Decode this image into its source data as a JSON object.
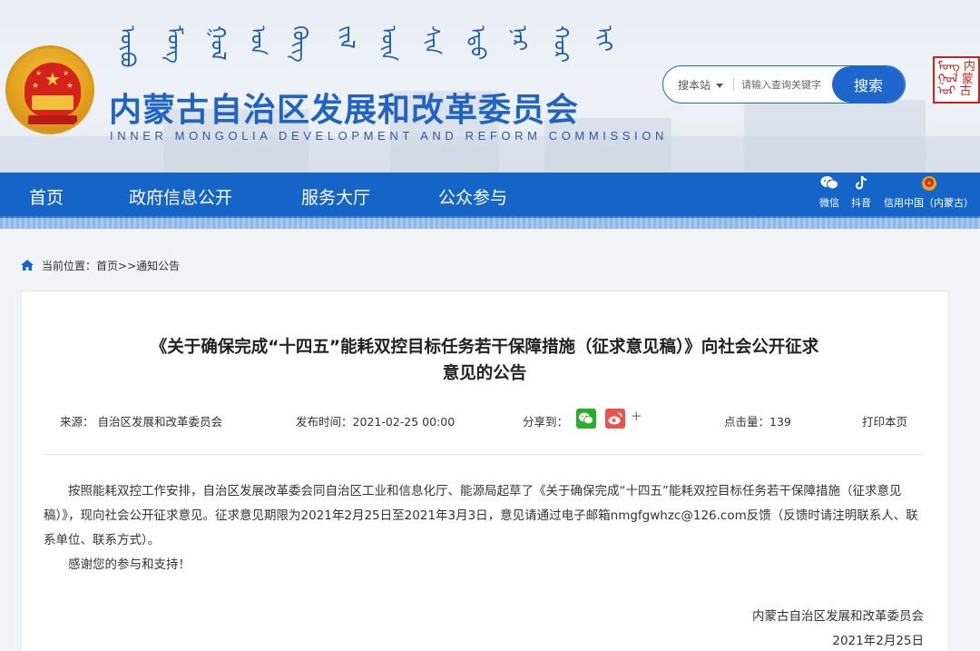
{
  "header": {
    "title": "内蒙古自治区发展和改革委员会",
    "subtitle": "INNER MONGOLIA DEVELOPMENT AND REFORM COMMISSION",
    "search": {
      "scope": "搜本站",
      "placeholder": "请输入查询关键字",
      "button": "搜索"
    }
  },
  "nav": {
    "items": [
      "首页",
      "政府信息公开",
      "服务大厅",
      "公众参与"
    ],
    "social": [
      {
        "label": "微信",
        "icon": "wechat-icon"
      },
      {
        "label": "抖音",
        "icon": "douyin-icon"
      },
      {
        "label": "信用中国（内蒙古）",
        "icon": "emblem-icon"
      }
    ]
  },
  "breadcrumb": {
    "prefix": "当前位置：",
    "home": "首页",
    "sep": ">>",
    "current": "通知公告"
  },
  "article": {
    "title_line1": "《关于确保完成“十四五”能耗双控目标任务若干保障措施（征求意见稿）》向社会公开征求",
    "title_line2": "意见的公告",
    "source": "来源：  自治区发展和改革委员会",
    "published": "发布时间：2021-02-25 00:00",
    "share_label": "分享到：",
    "share_more": "+",
    "views": "点击量：139",
    "print": "打印本页",
    "para1": "按照能耗双控工作安排，自治区发展改革委会同自治区工业和信息化厅、能源局起草了《关于确保完成“十四五”能耗双控目标任务若干保障措施（征求意见稿）》，现向社会公开征求意见。征求意见期限为2021年2月25日至2021年3月3日，意见请通过电子邮箱nmgfgwhzc@126.com反馈（反馈时请注明联系人、联系单位、联系方式）。",
    "para2": "感谢您的参与和支持！",
    "sign_org": "内蒙古自治区发展和改革委员会",
    "sign_date": "2021年2月25日"
  },
  "colors": {
    "primary": "#1565c8",
    "title_blue": "#1f63c4",
    "wechat": "#2aae2a",
    "weibo": "#e8534a"
  }
}
